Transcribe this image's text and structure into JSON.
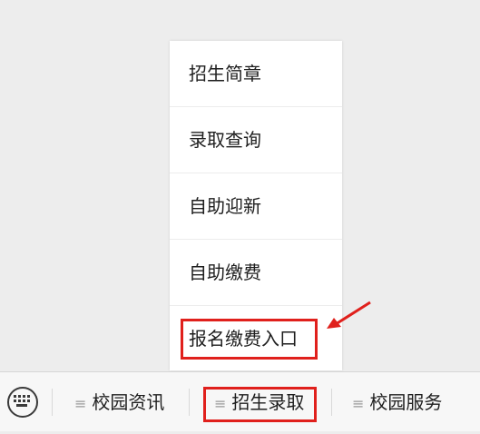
{
  "popup_menu": {
    "items": [
      {
        "label": "招生简章"
      },
      {
        "label": "录取查询"
      },
      {
        "label": "自助迎新"
      },
      {
        "label": "自助缴费"
      },
      {
        "label": "报名缴费入口"
      }
    ]
  },
  "bottom_bar": {
    "keyboard_icon": "keyboard-icon",
    "tabs": [
      {
        "label": "校园资讯",
        "icon": "menu-lines-icon"
      },
      {
        "label": "招生录取",
        "icon": "menu-lines-icon"
      },
      {
        "label": "校园服务",
        "icon": "menu-lines-icon"
      }
    ]
  },
  "colors": {
    "background": "#ededed",
    "highlight": "#e0201c",
    "text": "#1e1e1e"
  }
}
